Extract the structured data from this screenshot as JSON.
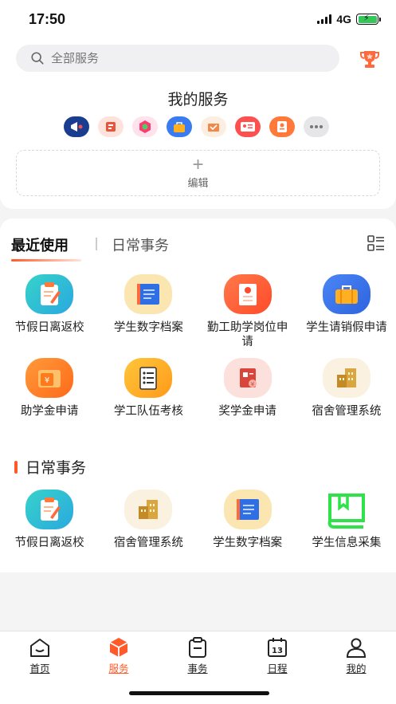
{
  "status": {
    "time": "17:50",
    "network": "4G"
  },
  "search": {
    "placeholder": "全部服务"
  },
  "my_services": {
    "title": "我的服务",
    "icons": [
      "megaphone-icon",
      "card-icon",
      "certificate-icon",
      "bag-icon",
      "box-icon",
      "id-card-icon",
      "award-icon",
      "more-icon"
    ],
    "edit_label": "编辑"
  },
  "tabs": {
    "recent": "最近使用",
    "daily": "日常事务"
  },
  "recent_items": [
    {
      "label": "节假日离返校",
      "icon": "clipboard-icon"
    },
    {
      "label": "学生数字档案",
      "icon": "folder-icon"
    },
    {
      "label": "勤工助学岗位申请",
      "icon": "job-certificate-icon"
    },
    {
      "label": "学生请销假申请",
      "icon": "briefcase-icon"
    },
    {
      "label": "助学金申请",
      "icon": "grant-folder-icon"
    },
    {
      "label": "学工队伍考核",
      "icon": "checklist-icon"
    },
    {
      "label": "奖学金申请",
      "icon": "scholarship-icon"
    },
    {
      "label": "宿舍管理系统",
      "icon": "building-icon"
    }
  ],
  "daily_section": {
    "title": "日常事务"
  },
  "daily_items": [
    {
      "label": "节假日离返校",
      "icon": "clipboard-icon"
    },
    {
      "label": "宿舍管理系统",
      "icon": "building-icon"
    },
    {
      "label": "学生数字档案",
      "icon": "folder-icon"
    },
    {
      "label": "学生信息采集",
      "icon": "info-book-icon"
    }
  ],
  "nav": [
    {
      "label": "首页",
      "icon": "home-icon",
      "active": false
    },
    {
      "label": "服务",
      "icon": "cube-icon",
      "active": true
    },
    {
      "label": "事务",
      "icon": "clipboard-list-icon",
      "active": false
    },
    {
      "label": "日程",
      "icon": "calendar-icon",
      "active": false,
      "badge": "13"
    },
    {
      "label": "我的",
      "icon": "user-icon",
      "active": false
    }
  ],
  "colors": {
    "accent": "#ff5a2a"
  }
}
